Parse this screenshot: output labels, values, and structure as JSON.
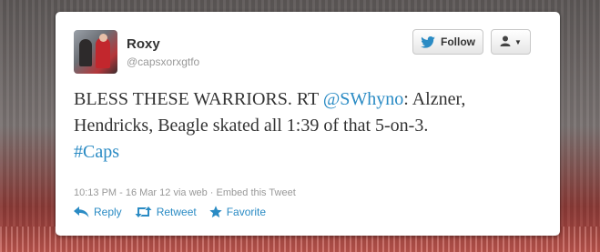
{
  "user": {
    "name": "Roxy",
    "handle": "@capsxorxgtfo"
  },
  "buttons": {
    "follow_label": "Follow"
  },
  "tweet": {
    "text_1": "BLESS THESE WARRIORS. RT ",
    "mention": "@SWhyno",
    "text_2": ": Alzner, Hendricks, Beagle skated all 1:39 of that 5-on-3.",
    "hashtag": "#Caps"
  },
  "meta": {
    "timestamp": "10:13 PM - 16 Mar 12",
    "source": " via web · ",
    "embed": "Embed this Tweet"
  },
  "actions": {
    "reply": "Reply",
    "retweet": "Retweet",
    "favorite": "Favorite"
  },
  "icons": {
    "follow": "twitter-bird-icon",
    "user_menu": "user-icon",
    "reply": "reply-arrow-icon",
    "retweet": "retweet-icon",
    "favorite": "star-icon"
  },
  "colors": {
    "link": "#2a8bc4",
    "text": "#333333",
    "muted": "#999999",
    "bird": "#2a8bc4"
  }
}
